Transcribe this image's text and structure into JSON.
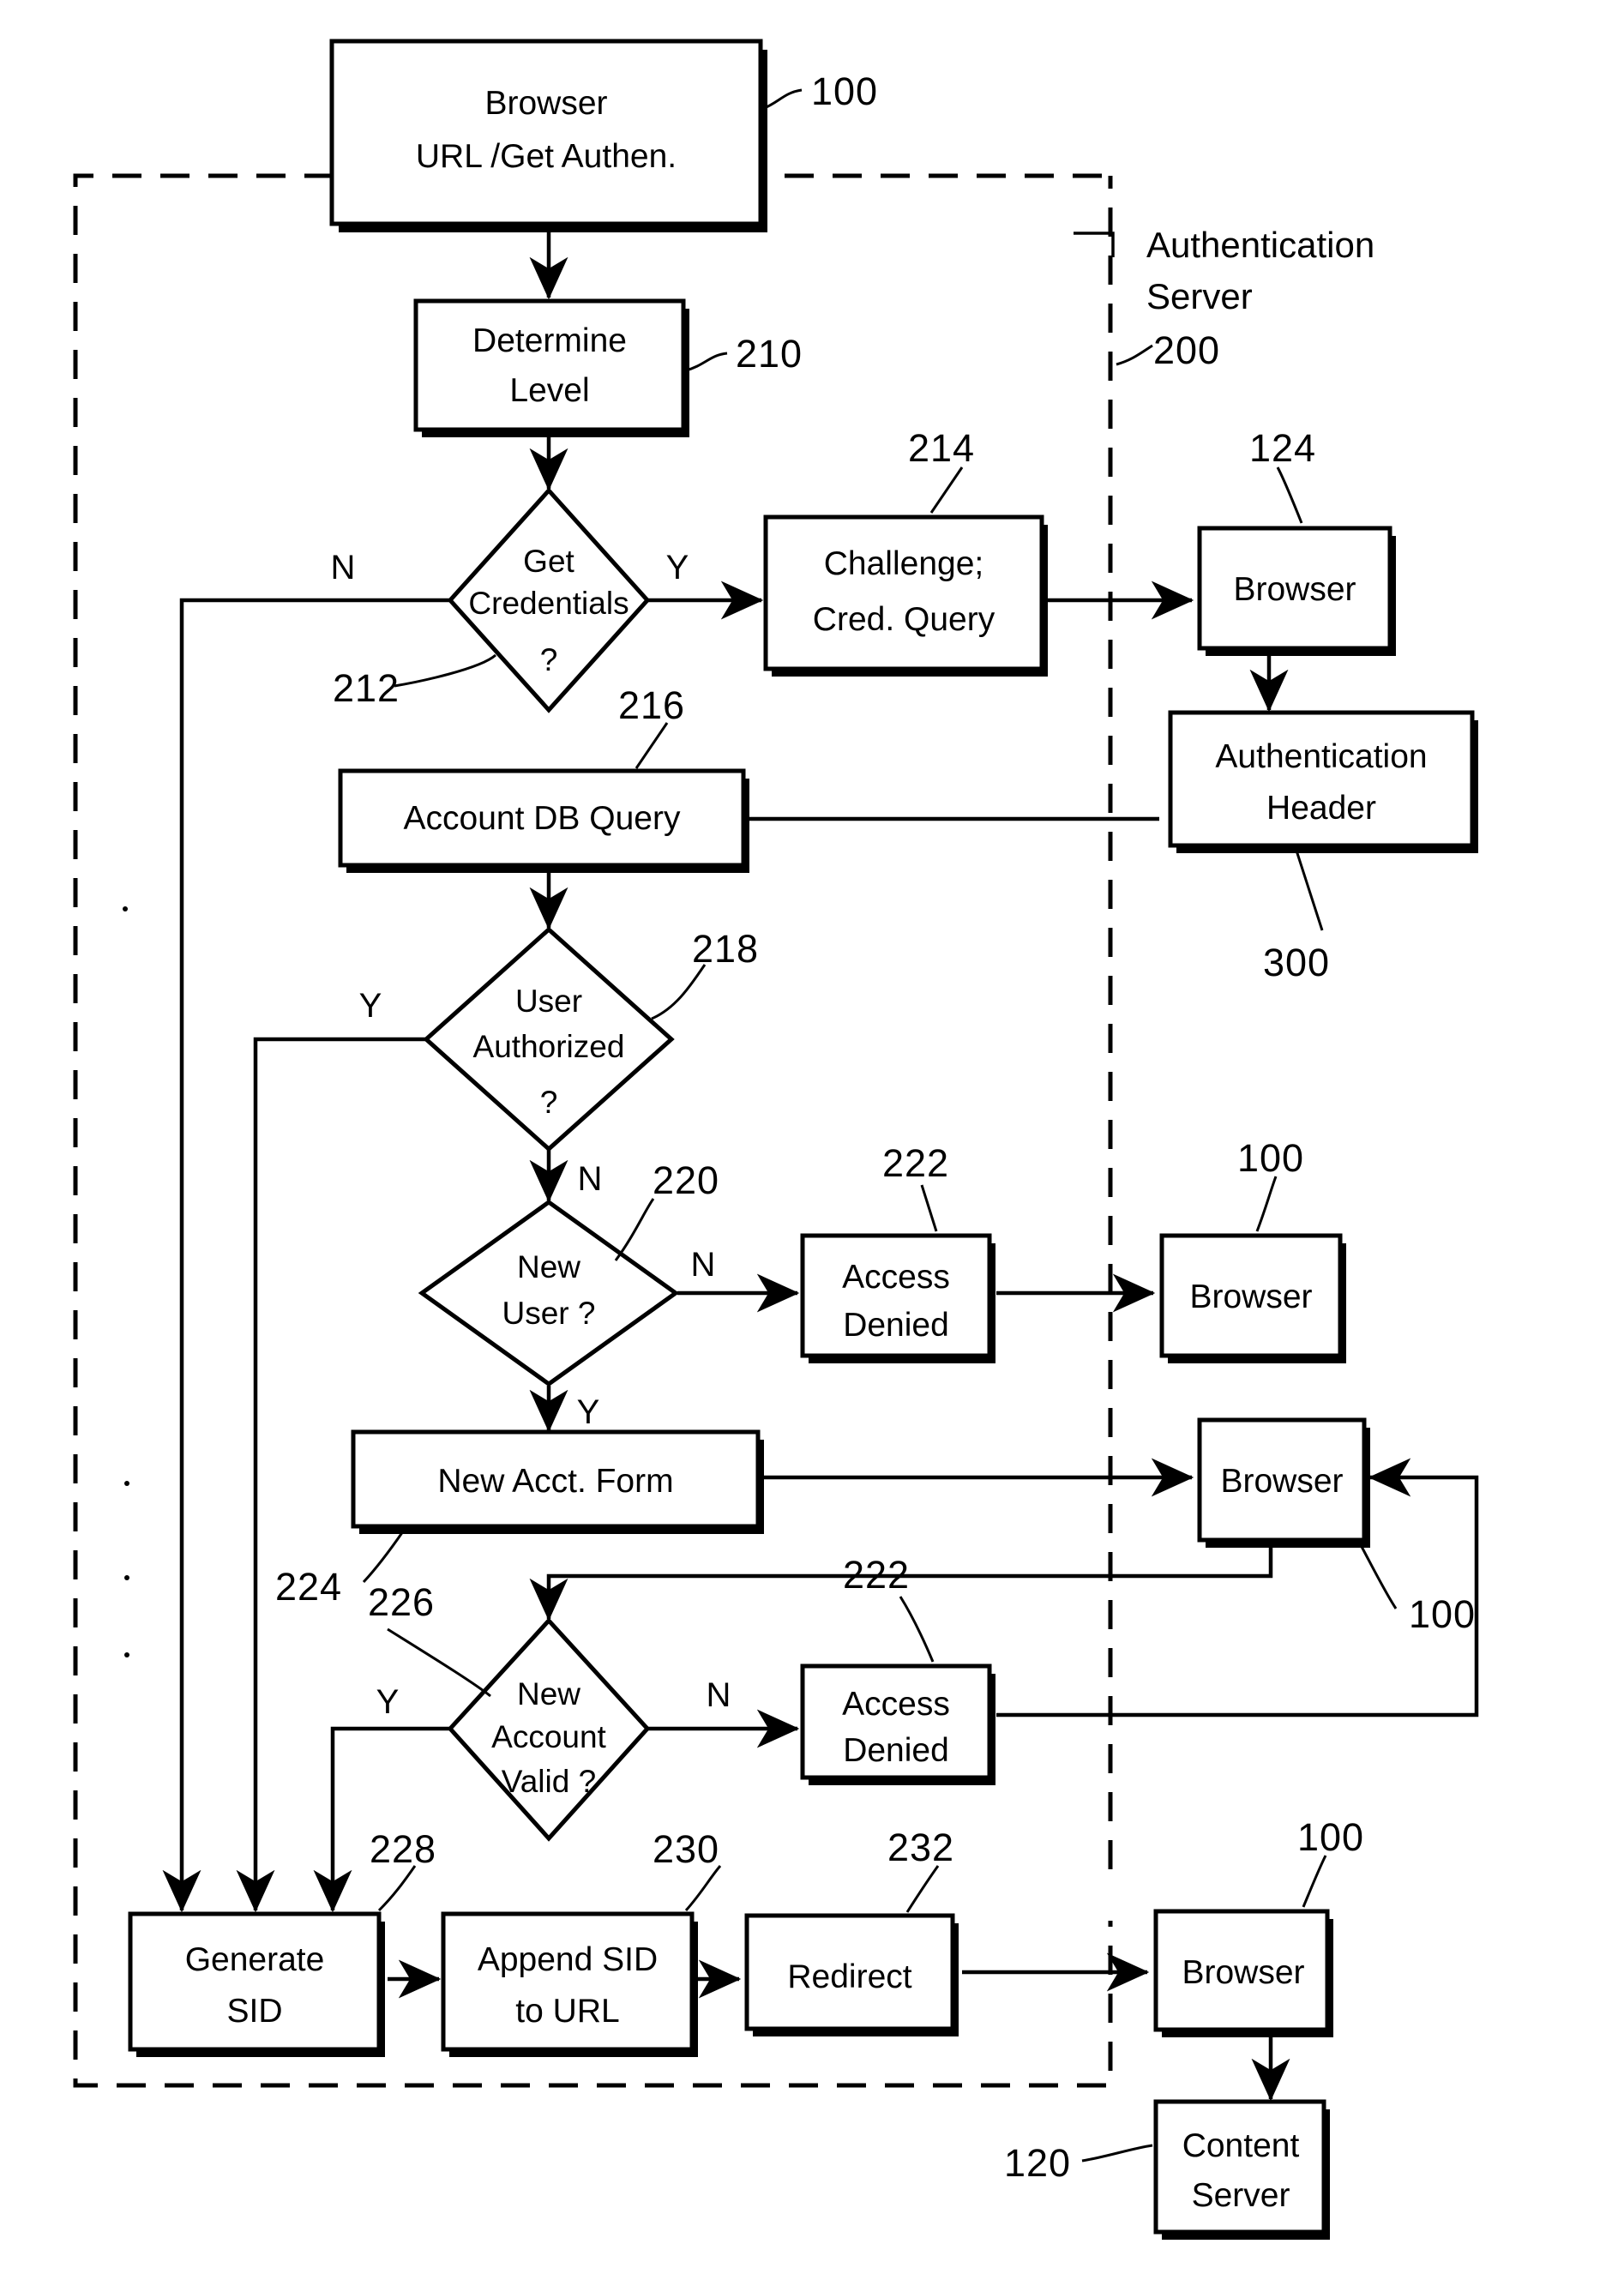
{
  "figure": {
    "type": "patent-flowchart",
    "title": "Authentication Server flow diagram",
    "group_label": {
      "line1": "Authentication",
      "line2": "Server",
      "ref": "200"
    }
  },
  "nodes": {
    "browser_top": {
      "kind": "process",
      "line1": "Browser",
      "line2": "URL /Get Authen.",
      "ref": "100"
    },
    "determine_level": {
      "kind": "process",
      "line1": "Determine",
      "line2": "Level",
      "ref": "210"
    },
    "get_credentials": {
      "kind": "decision",
      "line1": "Get",
      "line2": "Credentials",
      "line3": "?",
      "ref": "212",
      "yes": "Y",
      "no": "N"
    },
    "challenge": {
      "kind": "process",
      "line1": "Challenge;",
      "line2": "Cred. Query",
      "ref": "214"
    },
    "browser_124": {
      "kind": "process",
      "line1": "Browser",
      "line2": "",
      "ref": "124"
    },
    "auth_header": {
      "kind": "process",
      "line1": "Authentication",
      "line2": "Header",
      "ref": "300"
    },
    "account_db_query": {
      "kind": "process",
      "line1": "Account DB Query",
      "line2": "",
      "ref": "216"
    },
    "user_authorized": {
      "kind": "decision",
      "line1": "User",
      "line2": "Authorized",
      "line3": "?",
      "ref": "218",
      "yes": "Y",
      "no": "N"
    },
    "new_user": {
      "kind": "decision",
      "line1": "New",
      "line2": "User ?",
      "line3": "",
      "ref": "220",
      "yes": "Y",
      "no": "N"
    },
    "access_denied_1": {
      "kind": "process",
      "line1": "Access",
      "line2": "Denied",
      "ref": "222"
    },
    "browser_100_a": {
      "kind": "process",
      "line1": "Browser",
      "line2": "",
      "ref": "100"
    },
    "new_acct_form": {
      "kind": "process",
      "line1": "New Acct. Form",
      "line2": "",
      "ref": "224"
    },
    "browser_100_b": {
      "kind": "process",
      "line1": "Browser",
      "line2": "",
      "ref": "100"
    },
    "new_account_valid": {
      "kind": "decision",
      "line1": "New",
      "line2": "Account",
      "line3": "Valid ?",
      "ref": "226",
      "yes": "Y",
      "no": "N"
    },
    "access_denied_2": {
      "kind": "process",
      "line1": "Access",
      "line2": "Denied",
      "ref": "222"
    },
    "generate_sid": {
      "kind": "process",
      "line1": "Generate",
      "line2": "SID",
      "ref": "228"
    },
    "append_sid": {
      "kind": "process",
      "line1": "Append SID",
      "line2": "to URL",
      "ref": "230"
    },
    "redirect": {
      "kind": "process",
      "line1": "Redirect",
      "line2": "",
      "ref": "232"
    },
    "browser_100_c": {
      "kind": "process",
      "line1": "Browser",
      "line2": "",
      "ref": "100"
    },
    "content_server": {
      "kind": "process",
      "line1": "Content",
      "line2": "Server",
      "ref": "120"
    }
  },
  "edge_labels": {
    "get_credentials_no": "N",
    "get_credentials_yes": "Y",
    "user_authorized_yes": "Y",
    "user_authorized_no": "N",
    "new_user_no": "N",
    "new_user_yes": "Y",
    "new_account_valid_yes": "Y",
    "new_account_valid_no": "N"
  },
  "colors": {
    "ink": "#000000",
    "paper": "#ffffff"
  }
}
